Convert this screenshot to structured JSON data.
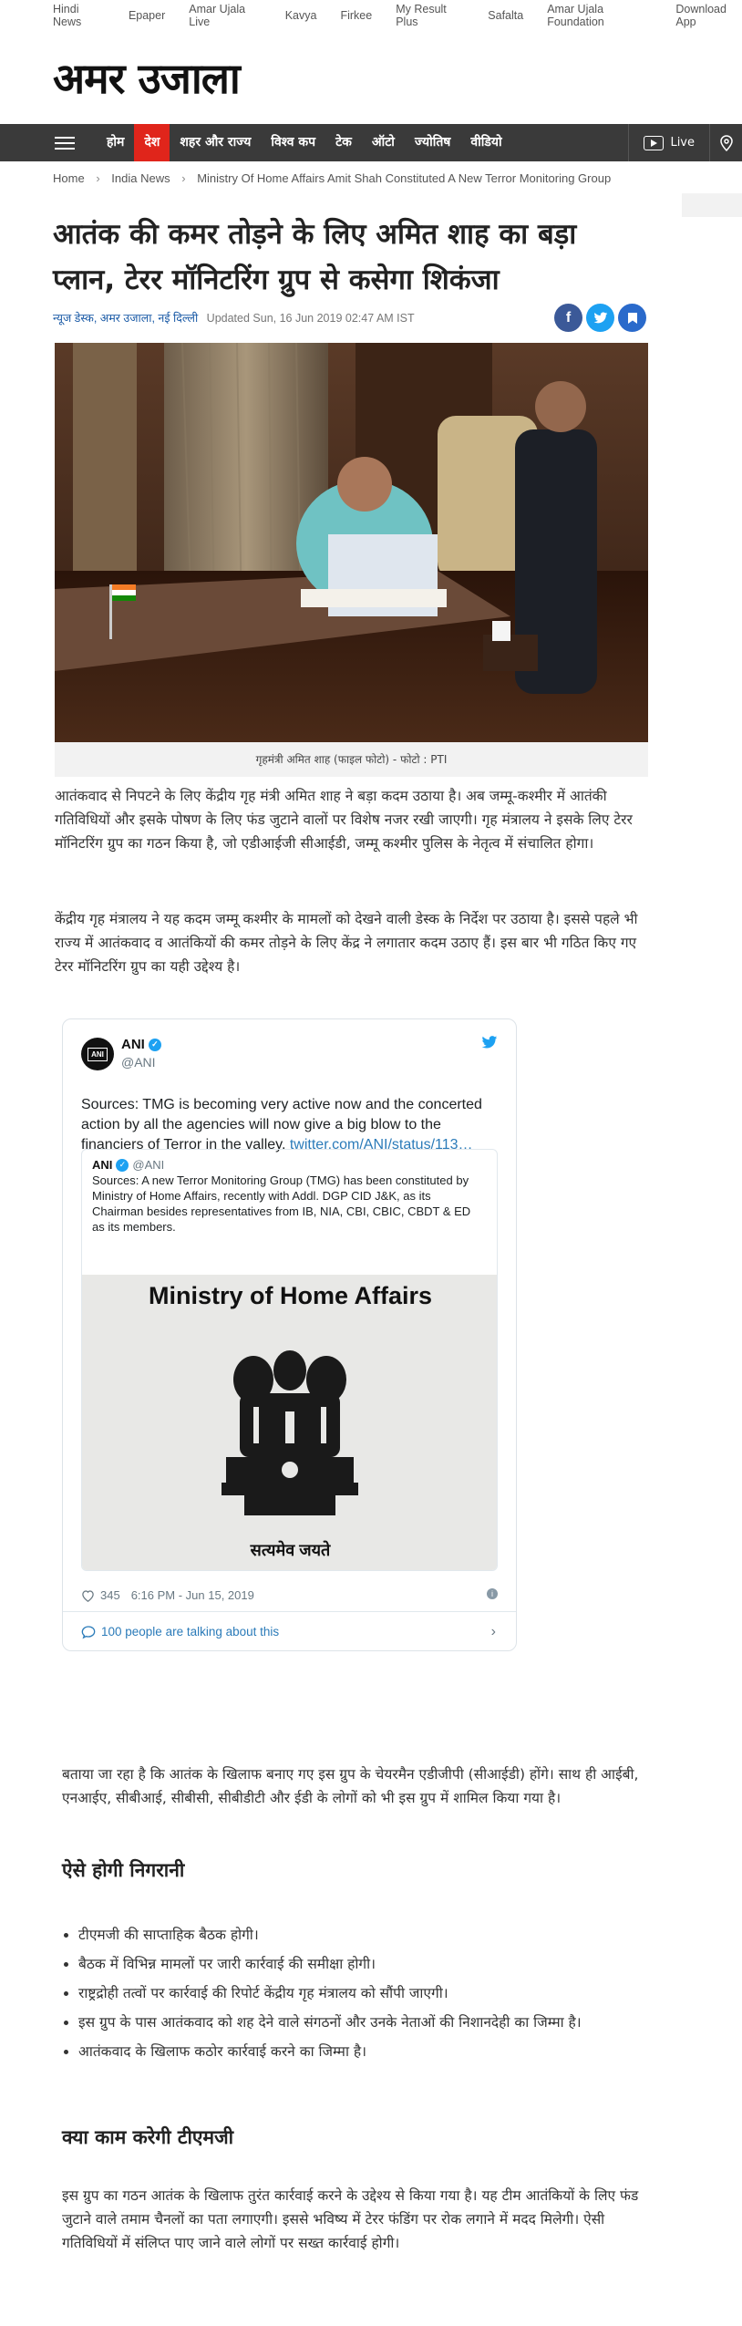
{
  "topbar": {
    "links": [
      "Hindi News",
      "Epaper",
      "Amar Ujala Live",
      "Kavya",
      "Firkee",
      "My Result Plus",
      "Safalta",
      "Amar Ujala Foundation",
      "Download App"
    ]
  },
  "logo_text": "अमर उजाला",
  "nav": {
    "items": [
      "होम",
      "देश",
      "शहर और राज्य",
      "विश्व कप",
      "टेक",
      "ऑटो",
      "ज्योतिष",
      "वीडियो"
    ],
    "active_index": 1,
    "live_label": "Live"
  },
  "breadcrumb": {
    "items": [
      "Home",
      "India News",
      "Ministry Of Home Affairs Amit Shah Constituted A New Terror Monitoring Group"
    ]
  },
  "article": {
    "headline": "आतंक की कमर तोड़ने के लिए अमित शाह का बड़ा प्लान, टेरर मॉनिटरिंग ग्रुप से कसेगा शिकंजा",
    "author": "न्यूज डेस्क, अमर उजाला, नई दिल्ली",
    "updated": "Updated Sun, 16 Jun 2019 02:47 AM IST",
    "photo_caption": "गृहमंत्री अमित शाह (फाइल फोटो) - फोटो : PTI",
    "para1": "आतंकवाद से निपटने के लिए केंद्रीय गृह मंत्री अमित शाह ने बड़ा कदम उठाया है। अब जम्मू-कश्मीर में आतंकी गतिविधियों और इसके पोषण के लिए फंड जुटाने वालों पर विशेष नजर रखी जाएगी। गृह मंत्रालय ने इसके लिए टेरर मॉनिटरिंग ग्रुप का गठन किया है, जो एडीआईजी सीआईडी, जम्मू कश्मीर पुलिस के नेतृत्व में संचालित होगा।",
    "para2": "केंद्रीय गृह मंत्रालय ने यह कदम जम्मू कश्मीर के मामलों को देखने वाली डेस्क के निर्देश पर उठाया है। इससे पहले भी राज्य में आतंकवाद व आतंकियों की कमर तोड़ने के लिए केंद्र ने लगातार कदम उठाए हैं। इस बार भी गठित किए गए टेरर मॉनिटरिंग ग्रुप का यही उद्देश्य है।",
    "para3": "बताया जा रहा है कि आतंक के खिलाफ बनाए गए इस ग्रुप के चेयरमैन एडीजीपी (सीआईडी) होंगे। साथ ही आईबी, एनआईए, सीबीआई, सीबीसी, सीबीडीटी और ईडी के लोगों को भी इस ग्रुप में शामिल किया गया है।",
    "heading1": "ऐसे होगी निगरानी",
    "bullets": [
      "टीएमजी की साप्ताहिक बैठक होगी।",
      "बैठक में विभिन्न मामलों पर जारी कार्रवाई की समीक्षा होगी।",
      "राष्ट्रद्रोही तत्वों पर कार्रवाई की रिपोर्ट केंद्रीय गृह मंत्रालय को सौंपी जाएगी।",
      "इस ग्रुप के पास आतंकवाद को शह देने वाले संगठनों और उनके नेताओं की निशानदेही का जिम्मा है।",
      "आतंकवाद के खिलाफ कठोर कार्रवाई करने का जिम्मा है।"
    ],
    "heading2": "क्या काम करेगी टीएमजी",
    "para4": "इस ग्रुप का गठन आतंक के खिलाफ तुरंत कार्रवाई करने के उद्देश्य से किया गया है। यह टीम आतंकियों के लिए फंड जुटाने वाले तमाम चैनलों का पता लगाएगी। इससे भविष्य में टेरर फंडिंग पर रोक लगाने में मदद मिलेगी। ऐसी गतिविधियों में संलिप्त पाए जाने वाले लोगों पर सख्त कार्रवाई होगी।"
  },
  "tweet": {
    "avatar_text": "ANI",
    "name": "ANI",
    "handle": "@ANI",
    "text": "Sources: TMG is becoming very active now and the concerted action by all the agencies will now give a big blow to the financiers of Terror in the valley.",
    "link": "twitter.com/ANI/status/113…",
    "quote_name": "ANI",
    "quote_handle": "@ANI",
    "quote_text": "Sources: A new Terror Monitoring Group (TMG) has been constituted by Ministry of Home Affairs, recently with Addl. DGP CID J&K, as its Chairman besides representatives from IB, NIA, CBI, CBIC, CBDT & ED as its members.",
    "image_title": "Ministry of Home Affairs",
    "image_motto": "सत्यमेव जयते",
    "likes": "345",
    "time": "6:16 PM - Jun 15, 2019",
    "talking": "100 people are talking about this"
  }
}
